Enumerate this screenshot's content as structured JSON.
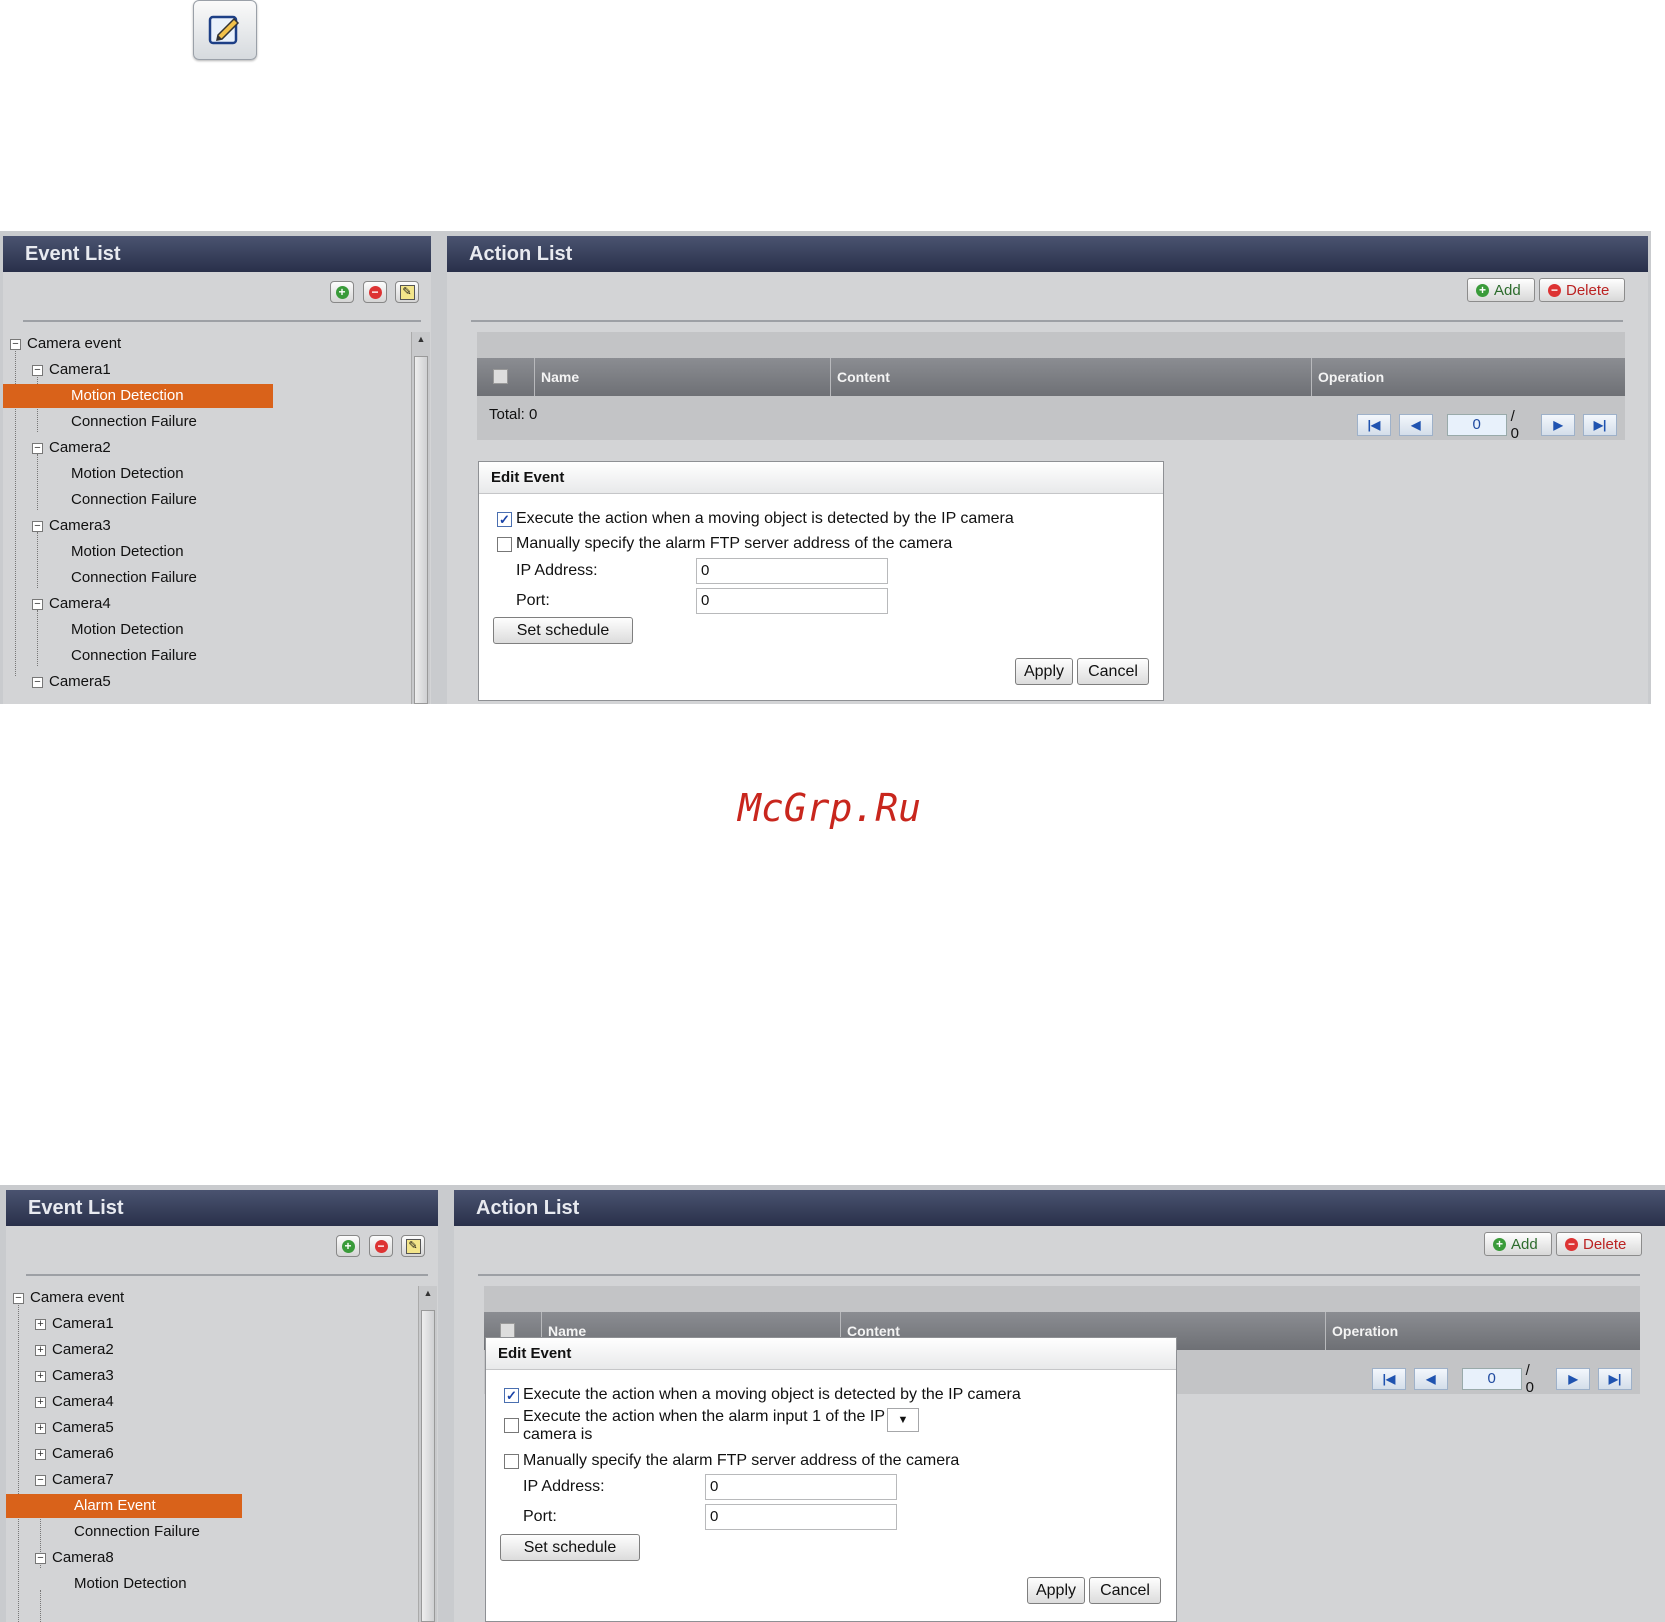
{
  "watermark": "McGrp.Ru",
  "top_icon": "edit-icon",
  "colors": {
    "header": "#29304a",
    "selection": "#d9621a",
    "watermark": "#c8261d"
  },
  "screen1": {
    "event_list": {
      "title": "Event List",
      "tree": [
        "Camera event",
        "Camera1",
        "Motion Detection",
        "Connection Failure",
        "Camera2",
        "Motion Detection",
        "Connection Failure",
        "Camera3",
        "Motion Detection",
        "Connection Failure",
        "Camera4",
        "Motion Detection",
        "Connection Failure",
        "Camera5"
      ],
      "selected": "Motion Detection"
    },
    "action_list": {
      "title": "Action List",
      "add_label": "Add",
      "delete_label": "Delete",
      "columns": [
        "Name",
        "Content",
        "Operation"
      ],
      "total_label": "Total:",
      "total_value": "0",
      "page_value": "0",
      "page_total": "/ 0"
    },
    "dialog": {
      "title": "Edit Event",
      "option1": "Execute the action when a moving object is detected by the IP camera",
      "option1_checked": true,
      "option2": "Manually specify the alarm FTP server address of the camera",
      "option2_checked": false,
      "ip_label": "IP Address:",
      "ip_value": "0",
      "port_label": "Port:",
      "port_value": "0",
      "schedule_label": "Set schedule",
      "apply_label": "Apply",
      "cancel_label": "Cancel"
    }
  },
  "screen2": {
    "event_list": {
      "title": "Event List",
      "tree": [
        "Camera event",
        "Camera1",
        "Camera2",
        "Camera3",
        "Camera4",
        "Camera5",
        "Camera6",
        "Camera7",
        "Alarm Event",
        "Connection Failure",
        "Camera8",
        "Motion Detection"
      ],
      "selected": "Alarm Event"
    },
    "action_list": {
      "title": "Action List",
      "add_label": "Add",
      "delete_label": "Delete",
      "columns": [
        "Name",
        "Content",
        "Operation"
      ],
      "page_value": "0",
      "page_total": "/ 0"
    },
    "dialog": {
      "title": "Edit Event",
      "option1": "Execute the action when a moving object is detected by the IP camera",
      "option1_checked": true,
      "option2_line1": "Execute the action when the alarm input 1 of the IP",
      "option2_line2": "camera is",
      "option2_checked": false,
      "option3": "Manually specify the alarm FTP server address of the camera",
      "option3_checked": false,
      "ip_label": "IP Address:",
      "ip_value": "0",
      "port_label": "Port:",
      "port_value": "0",
      "schedule_label": "Set schedule",
      "apply_label": "Apply",
      "cancel_label": "Cancel"
    }
  }
}
